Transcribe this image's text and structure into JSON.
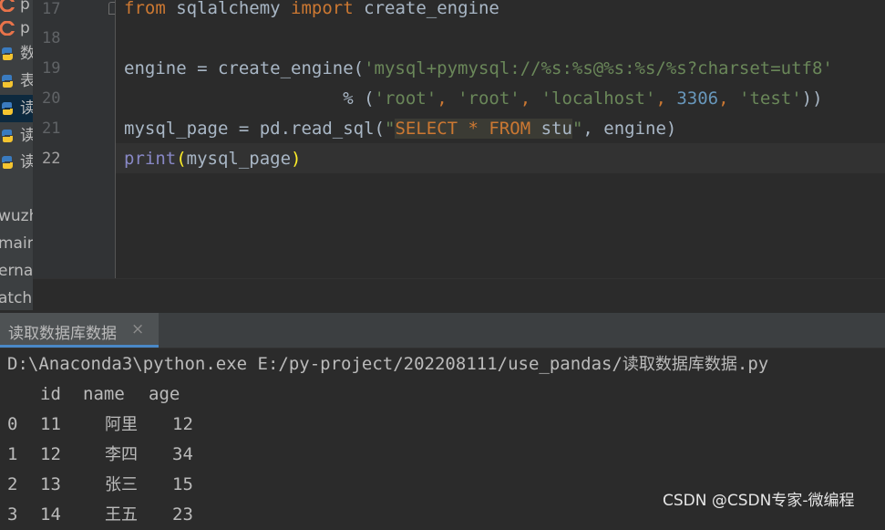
{
  "project_panel": {
    "rows": [
      {
        "text": "p",
        "icon": "java-c-icon"
      },
      {
        "text": "p",
        "icon": "java-c-icon"
      },
      {
        "text": "数",
        "icon": "python-icon"
      },
      {
        "text": "表",
        "icon": "python-icon"
      },
      {
        "text": "读",
        "icon": "python-icon",
        "selected": true
      },
      {
        "text": "读",
        "icon": "python-icon"
      },
      {
        "text": "读",
        "icon": "python-icon"
      },
      {
        "text": "wuzh"
      },
      {
        "text": "main"
      },
      {
        "text": "ernal"
      },
      {
        "text": "atche"
      }
    ]
  },
  "editor": {
    "line_numbers": [
      "17",
      "18",
      "19",
      "20",
      "21",
      "22"
    ],
    "current_line": "22",
    "code": {
      "l17": {
        "kw_from": "from",
        "mod": " sqlalchemy ",
        "kw_import": "import",
        "name": " create_engine"
      },
      "l19": {
        "lhs": "engine = create_engine(",
        "str": "'mysql+pymysql://%s:%s@%s:%s/%s?charset=utf8'"
      },
      "l20": {
        "indent": "                     ",
        "op": "% (",
        "s1": "'root'",
        "c1": ", ",
        "s2": "'root'",
        "c2": ", ",
        "s3": "'localhost'",
        "c3": ", ",
        "n1": "3306",
        "c4": ", ",
        "s4": "'test'",
        "close": "))"
      },
      "l21": {
        "lhs": "mysql_page = pd.read_sql(",
        "q_open": "\"",
        "sql_select": "SELECT",
        "sql_star": " * ",
        "sql_from": "FROM",
        "sql_rest": " stu",
        "q_close": "\"",
        "rest": ", engine)"
      },
      "l22": {
        "fn": "print",
        "open": "(",
        "arg": "mysql_page",
        "close": ")"
      }
    }
  },
  "run_window": {
    "tab_label": "读取数据库数据",
    "close_glyph": "×",
    "command": {
      "prefix": "D:\\Anaconda3\\python.exe E:/py-project/202208111/use_pandas/",
      "script": "读取数据库数据",
      "ext": ".py"
    },
    "header": {
      "id": "id",
      "name": "name",
      "age": "age"
    },
    "rows": [
      {
        "index": "0",
        "id": "11",
        "name": "阿里",
        "age": "12"
      },
      {
        "index": "1",
        "id": "12",
        "name": "李四",
        "age": "34"
      },
      {
        "index": "2",
        "id": "13",
        "name": "张三",
        "age": "15"
      },
      {
        "index": "3",
        "id": "14",
        "name": "王五",
        "age": "23"
      }
    ]
  },
  "watermark": "CSDN @CSDN专家-微编程",
  "colors": {
    "keyword": "#cc7832",
    "string": "#6a8759",
    "number": "#6897bb",
    "builtin": "#8888c6",
    "text": "#a9b7c6",
    "background": "#2b2b2b"
  }
}
